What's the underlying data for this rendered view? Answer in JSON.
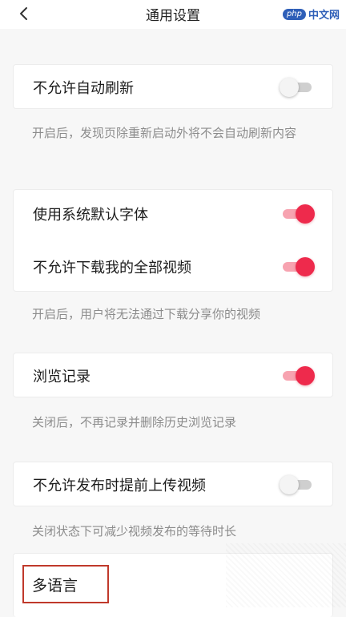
{
  "header": {
    "title": "通用设置",
    "back_icon": "chevron-left-icon"
  },
  "watermark": {
    "badge": "php",
    "text": "中文网"
  },
  "settings": {
    "auto_refresh": {
      "label": "不允许自动刷新",
      "enabled": false,
      "desc": "开启后，发现页除重新启动外将不会自动刷新内容"
    },
    "system_font": {
      "label": "使用系统默认字体",
      "enabled": true
    },
    "download_videos": {
      "label": "不允许下载我的全部视频",
      "enabled": true,
      "desc": "开启后，用户将无法通过下载分享你的视频"
    },
    "history": {
      "label": "浏览记录",
      "enabled": true,
      "desc": "关闭后，不再记录并删除历史浏览记录"
    },
    "pre_upload": {
      "label": "不允许发布时提前上传视频",
      "enabled": false,
      "desc": "关闭状态下可减少视频发布的等待时长"
    },
    "language": {
      "label": "多语言"
    }
  },
  "colors": {
    "accent": "#ee2a4c",
    "highlight_border": "#c0392b"
  }
}
